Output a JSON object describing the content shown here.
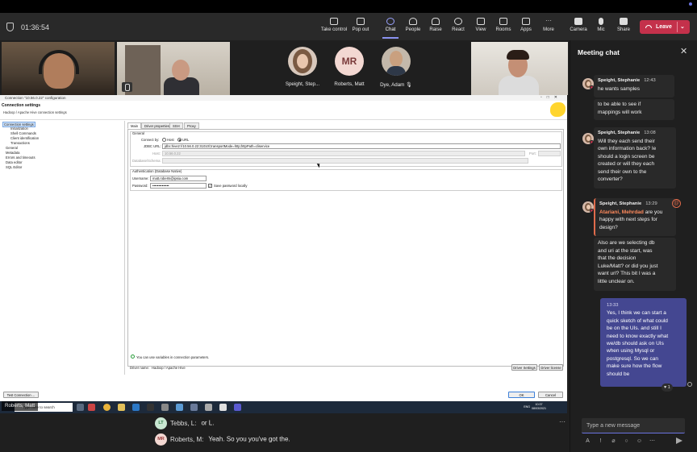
{
  "meeting": {
    "timer": "01:36:54"
  },
  "toolbar": {
    "items": [
      {
        "label": "Take control",
        "icon": "take-control-icon"
      },
      {
        "label": "Pop out",
        "icon": "pop-out-icon"
      },
      {
        "label": "Chat",
        "icon": "chat-icon",
        "active": true
      },
      {
        "label": "People",
        "icon": "people-icon"
      },
      {
        "label": "Raise",
        "icon": "raise-hand-icon"
      },
      {
        "label": "React",
        "icon": "react-icon"
      },
      {
        "label": "View",
        "icon": "view-icon"
      },
      {
        "label": "Rooms",
        "icon": "rooms-icon"
      },
      {
        "label": "Apps",
        "icon": "apps-icon"
      },
      {
        "label": "More",
        "icon": "more-icon"
      },
      {
        "label": "Camera",
        "icon": "camera-icon"
      },
      {
        "label": "Mic",
        "icon": "mic-icon"
      },
      {
        "label": "Share",
        "icon": "share-icon"
      }
    ],
    "leave_label": "Leave",
    "leave_color": "#c4314b",
    "accent": "#8b93f0"
  },
  "participants": [
    {
      "name": "Speight, Step..."
    },
    {
      "name": "Roberts, Matt",
      "initials": "MR"
    },
    {
      "name": "Dye, Adam"
    }
  ],
  "presenter": {
    "name": "Roberts, Matt"
  },
  "shared_screen": {
    "window_title": "Connection \"10.56.0.22\" configuration",
    "heading": "Connection settings",
    "subheading": "Hadoop / Apache Hive connection settings",
    "tree": [
      {
        "label": "Connection settings",
        "selected": true
      },
      {
        "label": "Initialization"
      },
      {
        "label": "Shell Commands"
      },
      {
        "label": "Client identification"
      },
      {
        "label": "Transactions"
      },
      {
        "label": "General"
      },
      {
        "label": "Metadata"
      },
      {
        "label": "Errors and timeouts"
      },
      {
        "label": "Data editor"
      },
      {
        "label": "SQL Editor"
      }
    ],
    "tabs": [
      "Main",
      "Driver properties",
      "SSH",
      "Proxy"
    ],
    "general_label": "General",
    "connect_by_label": "Connect by:",
    "host_label": "Host",
    "url_label": "URL",
    "jdbc_label": "JDBC URL:",
    "jdbc_value": "jdbc:hive2://10.56.0.22:31010/;transportMode=http;httpPath=cliservice",
    "host_field_label": "Host:",
    "host_value": "10.56.0.22",
    "port_label": "Port:",
    "database_label": "Database/Schema:",
    "auth_label": "Authentication (Database Native)",
    "username_label": "Username:",
    "username_value": "matt.roberts@ipsia.com",
    "password_label": "Password:",
    "password_value": "••••••••••••••",
    "save_password_label": "Save password locally",
    "variables_note": "You can use variables in connection parameters.",
    "driver_name_label": "Driver name:",
    "driver_name_value": "Hadoop / Apache Hive",
    "driver_settings_label": "Driver Settings",
    "driver_license_label": "Driver license",
    "test_connection_label": "Test Connection ...",
    "ok_label": "OK",
    "cancel_label": "Cancel",
    "taskbar_search": "Type here to search",
    "tray_time": "10:37",
    "tray_date": "08/03/2021",
    "tray_lang": "ENG"
  },
  "captions": [
    {
      "initials": "LT",
      "speaker": "Tebbs, L:",
      "text": "or L.",
      "color": "#c9e7d2",
      "text_color": "#2f7a45"
    },
    {
      "initials": "MR",
      "speaker": "Roberts, M:",
      "text": "Yeah. So you you've got the.",
      "color": "#f3d8d2",
      "text_color": "#9a3a3a"
    }
  ],
  "chat": {
    "title": "Meeting chat",
    "messages": [
      {
        "author": "Speight, Stephanie",
        "time": "12:43",
        "body": "he wants samples"
      },
      {
        "body": "to be able to see if\nmappings will work"
      },
      {
        "author": "Speight, Stephanie",
        "time": "13:08",
        "body": "Will they each send their\nown information back? Ie\nshould a login screen be\ncreated or will they each\nsend their own to the\nconverter?"
      },
      {
        "author": "Speight, Stephanie",
        "time": "13:29",
        "mention": "Atariani, Mehrdad",
        "body": " are you\nhappy with next steps for\ndesign?"
      },
      {
        "body": "Also are we selecting db\nand uri at the start, was\nthat the decision\nLuke/Matt? or did you just\nwant url? This bit I was a\nlittle unclear on."
      }
    ],
    "my_message": {
      "time": "13:33",
      "body": "Yes, I think we can start a\nquick sketch of what could\nbe on the UIs. and  still I\nneed to know exactly what\nwe/db should ask on UIs\nwhen using Mysql or\npostgresql. So we can\nmake sure how the flow\nshould be"
    },
    "reaction": "♥ 1",
    "compose_placeholder": "Type a new message",
    "my_bubble_color": "#444791"
  }
}
